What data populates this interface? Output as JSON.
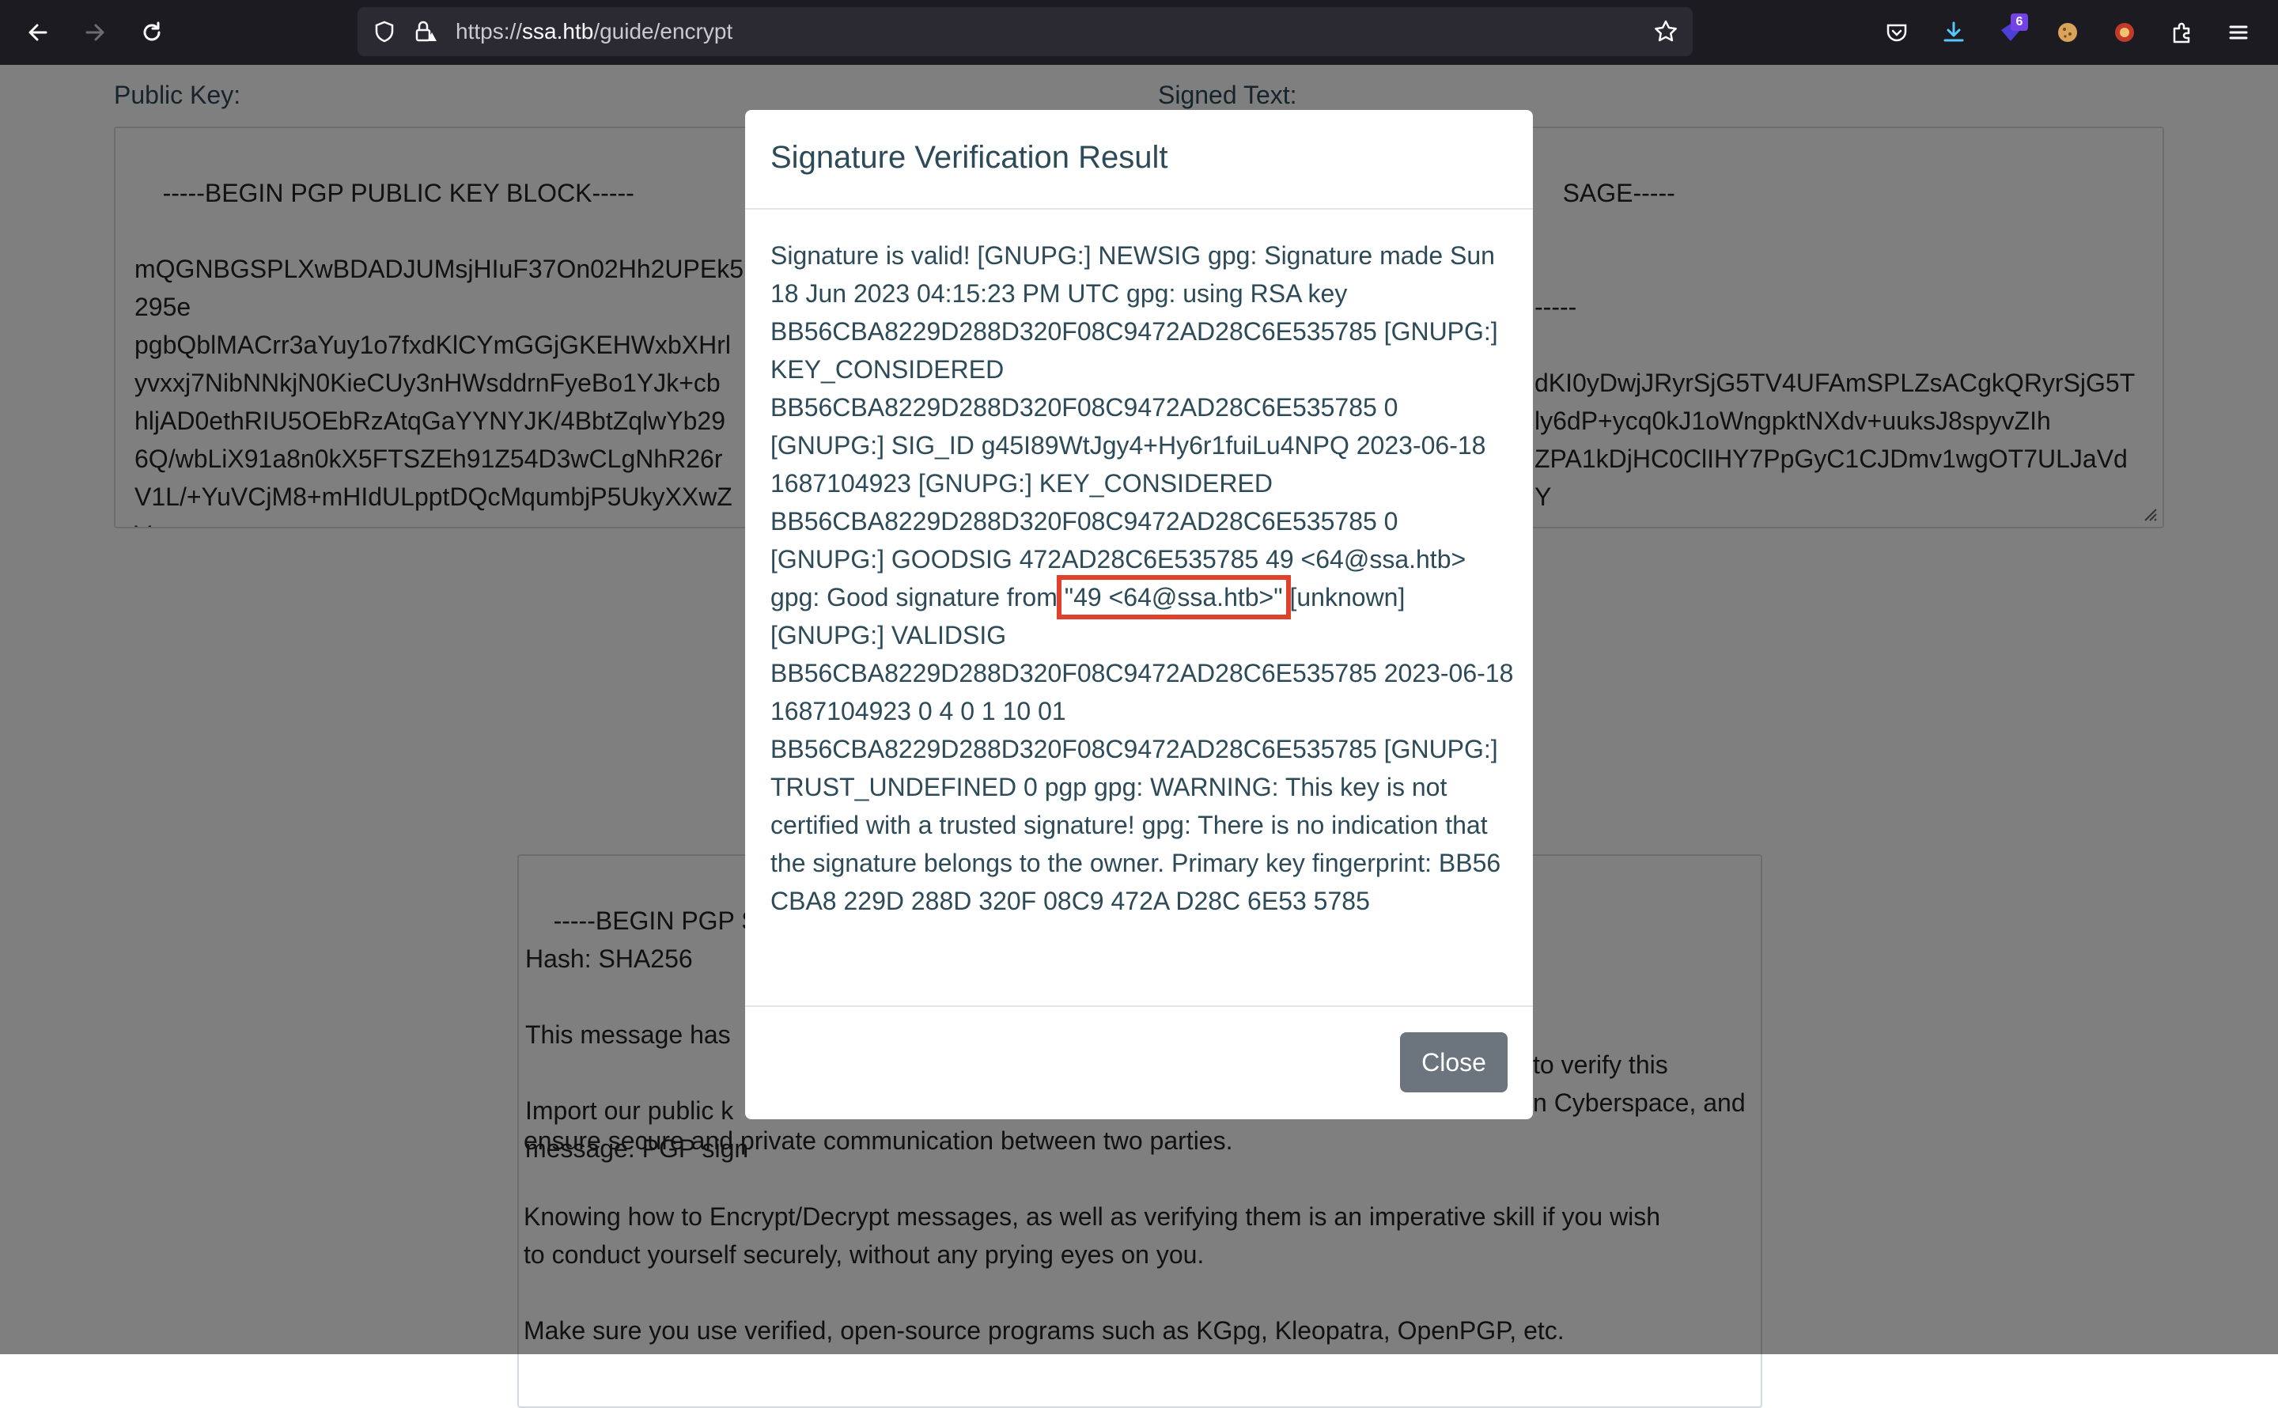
{
  "browser": {
    "url_prefix": "https://",
    "url_host": "ssa.htb",
    "url_path": "/guide/encrypt",
    "extension_badge": "6"
  },
  "page": {
    "public_key_label": "Public Key:",
    "signed_text_label": "Signed Text:",
    "public_key_visible": "-----BEGIN PGP PUBLIC KEY BLOCK-----\n\nmQGNBGSPLXwBDADJUMsjHIuF37On02Hh2UPEk5\n295e\npgbQblMACrr3aYuy1o7fxdKlCYmGGjGKEHWxbXHrl\nyvxxj7NibNNkjN0KieCUy3nHWsddrnFyeBo1YJk+cb\nhljAD0ethRIU5OEbRzAtqGaYYNYJK/4BbtZqlwYb29\n6Q/wbLiX91a8n0kX5FTSZEh91Z54D3wCLgNhR26r\nV1L/+YuVCjM8+mHIdULpptDQcMqumbjP5UkyXXwZ\nV",
    "signed_text_visible": "SAGE-----\n\n\n-----\n\ndKI0yDwjJRyrSjG5TV4UFAmSPLZsACgkQRyrSjG5T\nly6dP+ycq0kJ1oWngpktNXdv+uuksJ8spyvZIh\nZPA1kDjHC0ClIHY7PpGyC1CJDmv1wgOT7ULJaVdY",
    "bottom_left_visible": "-----BEGIN PGP SI\nHash: SHA256\n\nThis message has\n\nImport our public k\nmessage. PGP sign",
    "bottom_right_line1": "to verify this",
    "bottom_right_line2": "n Cyberspace, and",
    "bottom_full_1": "ensure secure and private communication between two parties.",
    "bottom_full_2": "Knowing how to Encrypt/Decrypt messages, as well as verifying them is an imperative skill if you wish",
    "bottom_full_3": "to conduct yourself securely, without any prying eyes on you.",
    "bottom_full_4": "Make sure you use verified, open-source programs such as KGpg, Kleopatra, OpenPGP, etc."
  },
  "modal": {
    "title": "Signature Verification Result",
    "body_before": "Signature is valid! [GNUPG:] NEWSIG gpg: Signature made Sun 18 Jun 2023 04:15:23 PM UTC gpg: using RSA key BB56CBA8229D288D320F08C9472AD28C6E535785 [GNUPG:] KEY_CONSIDERED BB56CBA8229D288D320F08C9472AD28C6E535785 0 [GNUPG:] SIG_ID g45I89WtJgy4+Hy6r1fuiLu4NPQ 2023-06-18 1687104923 [GNUPG:] KEY_CONSIDERED BB56CBA8229D288D320F08C9472AD28C6E535785 0 [GNUPG:] GOODSIG 472AD28C6E535785 49 <64@ssa.htb> gpg: Good signature from ",
    "body_highlight": "\"49 <64@ssa.htb>\"",
    "body_after": " [unknown] [GNUPG:] VALIDSIG BB56CBA8229D288D320F08C9472AD28C6E535785 2023-06-18 1687104923 0 4 0 1 10 01 BB56CBA8229D288D320F08C9472AD28C6E535785 [GNUPG:] TRUST_UNDEFINED 0 pgp gpg: WARNING: This key is not certified with a trusted signature! gpg: There is no indication that the signature belongs to the owner. Primary key fingerprint: BB56 CBA8 229D 288D 320F 08C9 472A D28C 6E53 5785",
    "close_label": "Close"
  }
}
